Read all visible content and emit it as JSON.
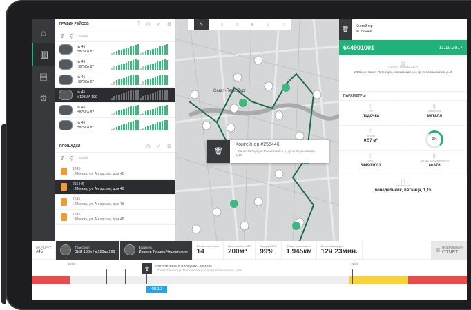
{
  "nav": {
    "items": [
      {
        "name": "home-icon",
        "glyph": "⌂"
      },
      {
        "name": "map-icon",
        "glyph": "▥"
      },
      {
        "name": "list-icon",
        "glyph": "▤"
      },
      {
        "name": "gear-icon",
        "glyph": "⚙"
      }
    ]
  },
  "schedule": {
    "title": "ГРАФИК РЕЙСОВ",
    "search_placeholder": "поиск",
    "rows": [
      {
        "no": "№ 45",
        "plate": "Н875КА 87",
        "bars": [
          2,
          3,
          4,
          5,
          6,
          7,
          8,
          9,
          10,
          11,
          12,
          13
        ]
      },
      {
        "no": "№ 45",
        "plate": "Н875КА 87",
        "bars": [
          3,
          4,
          5,
          6,
          7,
          8,
          9,
          10,
          11,
          12,
          13,
          12
        ]
      },
      {
        "no": "№ 45",
        "plate": "Н875КА 87",
        "bars": [
          2,
          4,
          6,
          7,
          8,
          9,
          10,
          11,
          12,
          13,
          13,
          12
        ]
      },
      {
        "no": "№ 45",
        "plate": "М123МА 199",
        "bars": [
          3,
          5,
          6,
          7,
          8,
          9,
          10,
          11,
          12,
          13,
          13,
          13
        ]
      },
      {
        "no": "№ 45",
        "plate": "Н875КА 87",
        "bars": [
          2,
          3,
          5,
          6,
          7,
          8,
          9,
          10,
          11,
          12,
          12,
          13
        ]
      },
      {
        "no": "№ 45",
        "plate": "Н875КА 87",
        "bars": [
          2,
          3,
          4,
          6,
          7,
          8,
          9,
          10,
          11,
          12,
          13,
          13
        ]
      }
    ]
  },
  "sites": {
    "title": "ПЛОЩАДКИ",
    "search_placeholder": "поиск",
    "rows": [
      {
        "no": "1245",
        "addr": "г. Москва, ул. Ангарская, дом 48"
      },
      {
        "no": "255446",
        "addr": "г. Москва, ул. Ангарская, дом 48"
      },
      {
        "no": "1245",
        "addr": "г. Москва, ул. Ангарская, дом 48"
      },
      {
        "no": "1245",
        "addr": "г. Москва, ул. Ангарская, дом 48"
      }
    ]
  },
  "map": {
    "city_label": "Санкт-Петербург",
    "popup_title": "Контейнер #255446",
    "popup_addr": "г. Санкт-Петербург, Московский р-н, пр-кт Космонавтов, д.46"
  },
  "details": {
    "caption": "Контейнер",
    "number": "№ 255446",
    "id": "644901001",
    "date_caption": "ПОДТВЕРЖДЕН",
    "date": "11.10.2017",
    "addr_caption": "АДРЕС ПЛОЩАДКИ",
    "addr": "620014, г. Санкт-Петербург, Московский р-н, пр-кт Космонавтов, д.46",
    "params_title": "ПАРАМЕТРЫ",
    "params": [
      {
        "cap": "тип",
        "val": "лодочка"
      },
      {
        "cap": "материал",
        "val": "металл"
      },
      {
        "cap": "объем",
        "val": "0.57 м³"
      },
      {
        "cap": "заполнение",
        "val": "3%"
      },
      {
        "cap": "инн",
        "val": "644901001"
      },
      {
        "cap": "датчик наполненности",
        "val": "№376"
      }
    ],
    "days_caption": "дни вывоза",
    "days": "понедельник, пятница, 1,15",
    "fill_level": 0.03
  },
  "route": {
    "caption": "МАРШРУТ",
    "number": "#45",
    "vehicle_caption": "Транспорт",
    "vehicle": "ЗИЛ 130и / м123ма199",
    "driver_caption": "Водитель",
    "driver": "Иванов Теодор Чесланович",
    "stats": [
      {
        "cap": "Кол-во остановок",
        "val": "14"
      },
      {
        "cap": "Вместимость АТС",
        "val": "200м³"
      },
      {
        "cap": "Загрузка АТС",
        "val": "99%"
      },
      {
        "cap": "Общее расстояние",
        "val": "1 945км"
      },
      {
        "cap": "Время маршрута",
        "val": "12ч 23мин."
      }
    ],
    "report_line1": "ПОДРОБНЫЙ",
    "report_line2": "ОТЧЕТ"
  },
  "timeline": {
    "card_title": "КОНТЕЙНЕРНАЯ ПЛОЩАДКА #255446",
    "card_addr": "г. Санкт-Петербург, Московский р-н, пр-кт Космонавтов, д.46",
    "cursor_time": "08:10",
    "start_label": "10:00",
    "mid_label": "11:30",
    "colors": {
      "red": "#e84c4c",
      "yellow": "#f7d23a",
      "blue": "#28a5e8",
      "green": "#21b17a"
    }
  }
}
